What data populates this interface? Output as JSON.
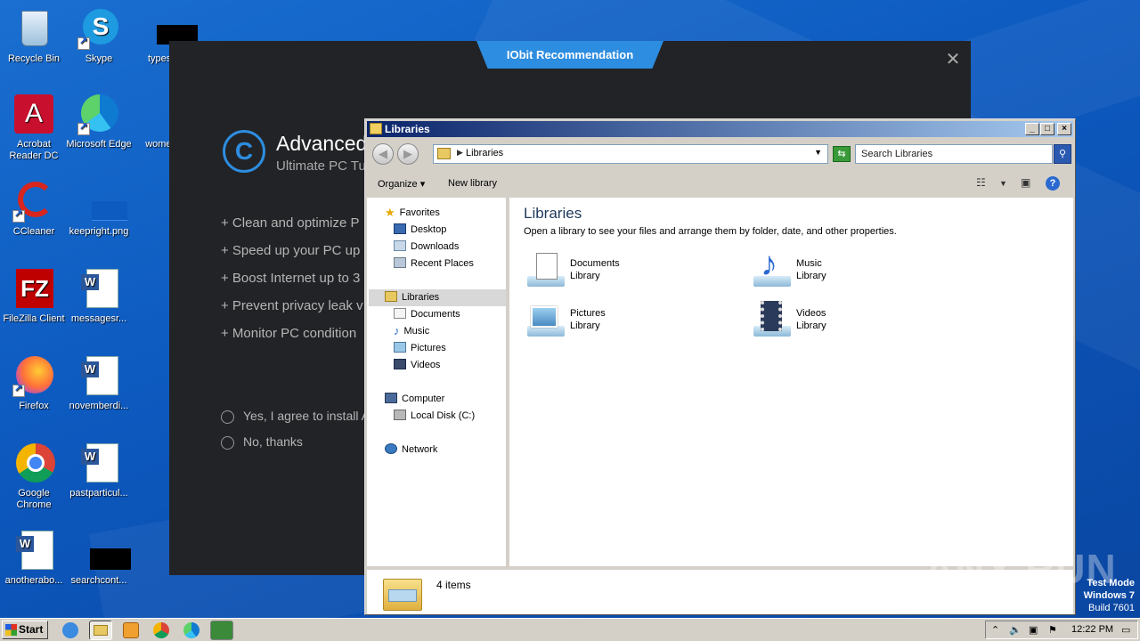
{
  "desktop": {
    "icons": [
      {
        "label": "Recycle Bin"
      },
      {
        "label": "Skype"
      },
      {
        "label": "typespr"
      },
      {
        "label": "Acrobat Reader DC"
      },
      {
        "label": "Microsoft Edge"
      },
      {
        "label": "womenb"
      },
      {
        "label": "CCleaner"
      },
      {
        "label": "keepright.png"
      },
      {
        "label": "FileZilla Client"
      },
      {
        "label": "messagesr..."
      },
      {
        "label": "Firefox"
      },
      {
        "label": "novemberdi..."
      },
      {
        "label": "Google Chrome"
      },
      {
        "label": "pastparticul..."
      },
      {
        "label": "anotherabo..."
      },
      {
        "label": "searchcont..."
      }
    ]
  },
  "iobit": {
    "tab_title": "IObit Recommendation",
    "close": "✕",
    "logo_letter": "C",
    "title": "Advanced",
    "subtitle": "Ultimate PC Tu",
    "features": [
      "+ Clean and optimize P",
      "+ Speed up your PC up",
      "+ Boost Internet up to 3",
      "+ Prevent privacy leak v",
      "+ Monitor PC condition"
    ],
    "options": [
      {
        "label": "Yes, I agree to install A"
      },
      {
        "label": "No, thanks"
      }
    ]
  },
  "explorer": {
    "title": "Libraries",
    "address": "Libraries",
    "search_placeholder": "Search Libraries",
    "toolbar": {
      "organize": "Organize",
      "new_library": "New library"
    },
    "nav": {
      "favorites": "Favorites",
      "desktop": "Desktop",
      "downloads": "Downloads",
      "recent": "Recent Places",
      "libraries": "Libraries",
      "documents": "Documents",
      "music": "Music",
      "pictures": "Pictures",
      "videos": "Videos",
      "computer": "Computer",
      "local_disk": "Local Disk (C:)",
      "network": "Network"
    },
    "content": {
      "heading": "Libraries",
      "description": "Open a library to see your files and arrange them by folder, date, and other properties.",
      "libraries": [
        {
          "name": "Documents",
          "type": "Library"
        },
        {
          "name": "Music",
          "type": "Library"
        },
        {
          "name": "Pictures",
          "type": "Library"
        },
        {
          "name": "Videos",
          "type": "Library"
        }
      ]
    },
    "status": "4 items"
  },
  "watermark": "ANY RUN",
  "test_mode": {
    "line1": "Test Mode",
    "line2": "Windows 7",
    "line3": "Build 7601"
  },
  "taskbar": {
    "start": "Start",
    "clock": "12:22 PM"
  }
}
